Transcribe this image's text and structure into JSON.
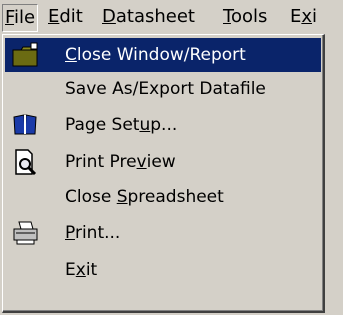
{
  "menubar": {
    "items": [
      {
        "label": "File",
        "mnemonic": "F"
      },
      {
        "label": "Edit",
        "mnemonic": "E"
      },
      {
        "label": "Datasheet",
        "mnemonic": "D"
      },
      {
        "label": "Tools",
        "mnemonic": "T"
      },
      {
        "label": "Exi",
        "mnemonic": "x"
      }
    ]
  },
  "menu": {
    "items": [
      {
        "label": "Close Window/Report",
        "mnemonic": "C",
        "icon": "folder-icon",
        "highlighted": true
      },
      {
        "label": "Save As/Export Datafile",
        "mnemonic": "",
        "icon": ""
      },
      {
        "label": "Page Setup...",
        "mnemonic": "u",
        "icon": "open-book-icon"
      },
      {
        "label": "Print Preview",
        "mnemonic": "v",
        "icon": "print-preview-icon"
      },
      {
        "label": "Close Spreadsheet",
        "mnemonic": "S",
        "icon": ""
      },
      {
        "label": "Print...",
        "mnemonic": "P",
        "icon": "printer-icon"
      },
      {
        "label": "Exit",
        "mnemonic": "x",
        "icon": ""
      }
    ]
  },
  "colors": {
    "face": "#d4d0c8",
    "highlight": "#0a246a",
    "highlight_text": "#ffffff",
    "text": "#000000"
  }
}
